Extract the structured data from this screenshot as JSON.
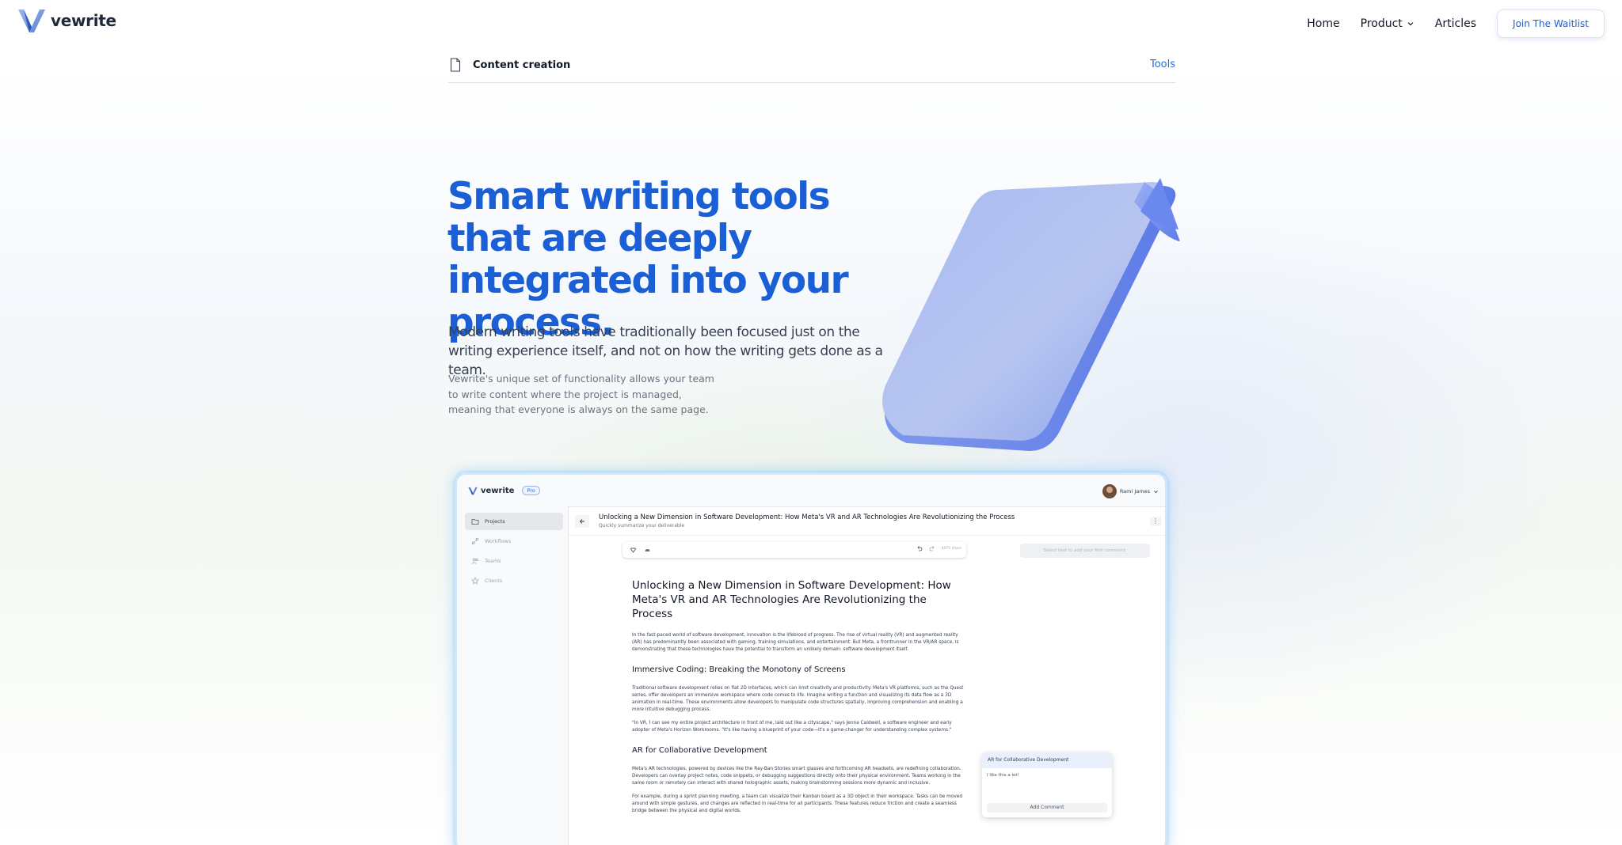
{
  "nav": {
    "brand": "vewrite",
    "links": [
      {
        "label": "Home"
      },
      {
        "label": "Product"
      },
      {
        "label": "Articles"
      }
    ],
    "cta": "Join The Waitlist"
  },
  "breadcrumb": {
    "title": "Content creation",
    "right_link": "Tools"
  },
  "hero": {
    "title": "Smart writing tools that are deeply integrated into your process.",
    "subtitle": "Modern writing tools have traditionally been focused just on the writing experience itself, and not on how the writing gets done as a team.",
    "body": "Vewrite's unique set of functionality allows your team to write content where the project is managed, meaning that everyone is always on the same page."
  },
  "app": {
    "brand": "vewrite",
    "badge": "Pro",
    "user": "Rami James",
    "sidebar": [
      {
        "label": "Projects",
        "icon": "folder-icon"
      },
      {
        "label": "Workflows",
        "icon": "workflow-icon"
      },
      {
        "label": "Teams",
        "icon": "users-icon"
      },
      {
        "label": "Clients",
        "icon": "star-icon"
      }
    ],
    "doc": {
      "title": "Unlocking a New Dimension in Software Development: How Meta's VR and AR Technologies Are Revolutionizing the Process",
      "description": "Quickly summarize your deliverable",
      "char_count": "4075 chars",
      "comment_hint": "Select text to add your first comment.",
      "h1": "Unlocking a New Dimension in Software Development: How Meta's VR and AR Technologies Are Revolutionizing the Process",
      "p1": "In the fast-paced world of software development, innovation is the lifeblood of progress. The rise of virtual reality (VR) and augmented reality (AR) has predominantly been associated with gaming, training simulations, and entertainment. But Meta, a frontrunner in the VR/AR space, is demonstrating that these technologies have the potential to transform an unlikely domain: software development itself.",
      "h2a": "Immersive Coding: Breaking the Monotony of Screens",
      "p2": "Traditional software development relies on flat 2D interfaces, which can limit creativity and productivity. Meta's VR platforms, such as the Quest series, offer developers an immersive workspace where code comes to life. Imagine writing a function and visualizing its data flow as a 3D animation in real-time. These environments allow developers to manipulate code structures spatially, improving comprehension and enabling a more intuitive debugging process.",
      "p3": "\"In VR, I can see my entire project architecture in front of me, laid out like a cityscape,\" says Jenna Caldwell, a software engineer and early adopter of Meta's Horizon Workrooms. \"It's like having a blueprint of your code—it's a game-changer for understanding complex systems.\"",
      "h2b": "AR for Collaborative Development",
      "p4": "Meta's AR technologies, powered by devices like the Ray-Ban Stories smart glasses and forthcoming AR headsets, are redefining collaboration. Developers can overlay project notes, code snippets, or debugging suggestions directly onto their physical environment. Teams working in the same room or remotely can interact with shared holographic assets, making brainstorming sessions more dynamic and inclusive.",
      "p5": "For example, during a sprint planning meeting, a team can visualize their Kanban board as a 3D object in their workspace. Tasks can be moved around with simple gestures, and changes are reflected in real-time for all participants. These features reduce friction and create a seamless bridge between the physical and digital worlds."
    },
    "comment": {
      "title": "AR for Collaborative Development",
      "text": "I like this a lot!",
      "button": "Add Comment"
    }
  },
  "colors": {
    "accent": "#1a5fd5",
    "link": "#2b6bd9"
  }
}
